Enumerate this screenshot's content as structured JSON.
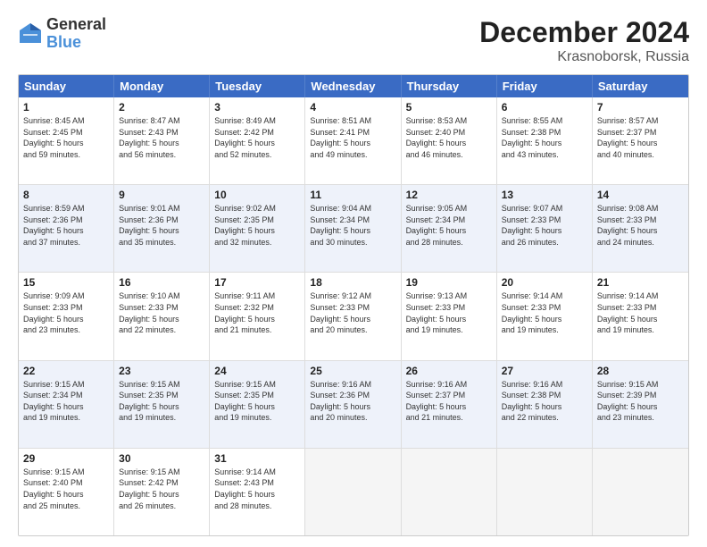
{
  "header": {
    "logo_line1": "General",
    "logo_line2": "Blue",
    "title": "December 2024",
    "subtitle": "Krasnoborsk, Russia"
  },
  "weekdays": [
    "Sunday",
    "Monday",
    "Tuesday",
    "Wednesday",
    "Thursday",
    "Friday",
    "Saturday"
  ],
  "rows": [
    [
      {
        "day": "1",
        "info": "Sunrise: 8:45 AM\nSunset: 2:45 PM\nDaylight: 5 hours\nand 59 minutes."
      },
      {
        "day": "2",
        "info": "Sunrise: 8:47 AM\nSunset: 2:43 PM\nDaylight: 5 hours\nand 56 minutes."
      },
      {
        "day": "3",
        "info": "Sunrise: 8:49 AM\nSunset: 2:42 PM\nDaylight: 5 hours\nand 52 minutes."
      },
      {
        "day": "4",
        "info": "Sunrise: 8:51 AM\nSunset: 2:41 PM\nDaylight: 5 hours\nand 49 minutes."
      },
      {
        "day": "5",
        "info": "Sunrise: 8:53 AM\nSunset: 2:40 PM\nDaylight: 5 hours\nand 46 minutes."
      },
      {
        "day": "6",
        "info": "Sunrise: 8:55 AM\nSunset: 2:38 PM\nDaylight: 5 hours\nand 43 minutes."
      },
      {
        "day": "7",
        "info": "Sunrise: 8:57 AM\nSunset: 2:37 PM\nDaylight: 5 hours\nand 40 minutes."
      }
    ],
    [
      {
        "day": "8",
        "info": "Sunrise: 8:59 AM\nSunset: 2:36 PM\nDaylight: 5 hours\nand 37 minutes."
      },
      {
        "day": "9",
        "info": "Sunrise: 9:01 AM\nSunset: 2:36 PM\nDaylight: 5 hours\nand 35 minutes."
      },
      {
        "day": "10",
        "info": "Sunrise: 9:02 AM\nSunset: 2:35 PM\nDaylight: 5 hours\nand 32 minutes."
      },
      {
        "day": "11",
        "info": "Sunrise: 9:04 AM\nSunset: 2:34 PM\nDaylight: 5 hours\nand 30 minutes."
      },
      {
        "day": "12",
        "info": "Sunrise: 9:05 AM\nSunset: 2:34 PM\nDaylight: 5 hours\nand 28 minutes."
      },
      {
        "day": "13",
        "info": "Sunrise: 9:07 AM\nSunset: 2:33 PM\nDaylight: 5 hours\nand 26 minutes."
      },
      {
        "day": "14",
        "info": "Sunrise: 9:08 AM\nSunset: 2:33 PM\nDaylight: 5 hours\nand 24 minutes."
      }
    ],
    [
      {
        "day": "15",
        "info": "Sunrise: 9:09 AM\nSunset: 2:33 PM\nDaylight: 5 hours\nand 23 minutes."
      },
      {
        "day": "16",
        "info": "Sunrise: 9:10 AM\nSunset: 2:33 PM\nDaylight: 5 hours\nand 22 minutes."
      },
      {
        "day": "17",
        "info": "Sunrise: 9:11 AM\nSunset: 2:32 PM\nDaylight: 5 hours\nand 21 minutes."
      },
      {
        "day": "18",
        "info": "Sunrise: 9:12 AM\nSunset: 2:33 PM\nDaylight: 5 hours\nand 20 minutes."
      },
      {
        "day": "19",
        "info": "Sunrise: 9:13 AM\nSunset: 2:33 PM\nDaylight: 5 hours\nand 19 minutes."
      },
      {
        "day": "20",
        "info": "Sunrise: 9:14 AM\nSunset: 2:33 PM\nDaylight: 5 hours\nand 19 minutes."
      },
      {
        "day": "21",
        "info": "Sunrise: 9:14 AM\nSunset: 2:33 PM\nDaylight: 5 hours\nand 19 minutes."
      }
    ],
    [
      {
        "day": "22",
        "info": "Sunrise: 9:15 AM\nSunset: 2:34 PM\nDaylight: 5 hours\nand 19 minutes."
      },
      {
        "day": "23",
        "info": "Sunrise: 9:15 AM\nSunset: 2:35 PM\nDaylight: 5 hours\nand 19 minutes."
      },
      {
        "day": "24",
        "info": "Sunrise: 9:15 AM\nSunset: 2:35 PM\nDaylight: 5 hours\nand 19 minutes."
      },
      {
        "day": "25",
        "info": "Sunrise: 9:16 AM\nSunset: 2:36 PM\nDaylight: 5 hours\nand 20 minutes."
      },
      {
        "day": "26",
        "info": "Sunrise: 9:16 AM\nSunset: 2:37 PM\nDaylight: 5 hours\nand 21 minutes."
      },
      {
        "day": "27",
        "info": "Sunrise: 9:16 AM\nSunset: 2:38 PM\nDaylight: 5 hours\nand 22 minutes."
      },
      {
        "day": "28",
        "info": "Sunrise: 9:15 AM\nSunset: 2:39 PM\nDaylight: 5 hours\nand 23 minutes."
      }
    ],
    [
      {
        "day": "29",
        "info": "Sunrise: 9:15 AM\nSunset: 2:40 PM\nDaylight: 5 hours\nand 25 minutes."
      },
      {
        "day": "30",
        "info": "Sunrise: 9:15 AM\nSunset: 2:42 PM\nDaylight: 5 hours\nand 26 minutes."
      },
      {
        "day": "31",
        "info": "Sunrise: 9:14 AM\nSunset: 2:43 PM\nDaylight: 5 hours\nand 28 minutes."
      },
      {
        "day": "",
        "info": ""
      },
      {
        "day": "",
        "info": ""
      },
      {
        "day": "",
        "info": ""
      },
      {
        "day": "",
        "info": ""
      }
    ]
  ]
}
